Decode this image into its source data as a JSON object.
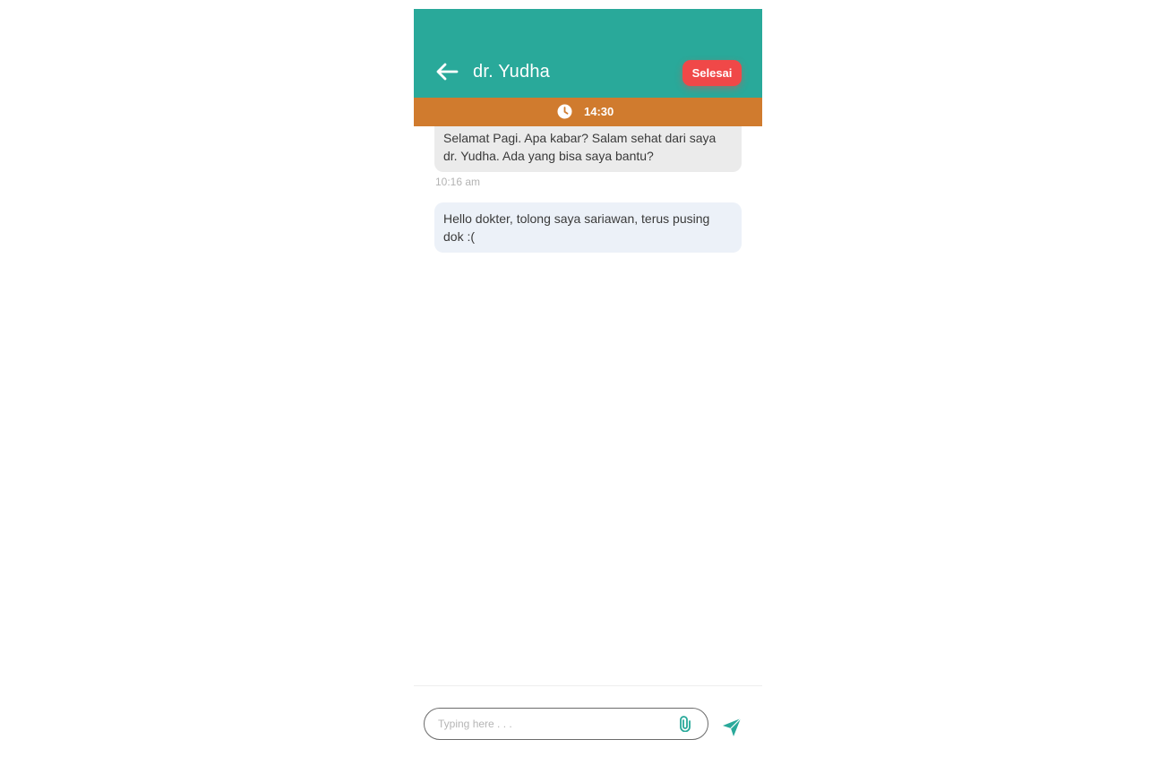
{
  "header": {
    "title": "dr. Yudha",
    "end_button": "Selesai",
    "back_icon": "arrow-left-icon",
    "color": "#29a99a"
  },
  "timer": {
    "value": "14:30",
    "icon": "clock-icon",
    "color": "#d07b2e"
  },
  "messages": [
    {
      "sender": "doctor",
      "text": "Selamat Pagi. Apa kabar? Salam sehat dari saya dr. Yudha. Ada yang bisa saya bantu?",
      "time": "10:16 am"
    },
    {
      "sender": "user",
      "text": "Hello dokter, tolong saya sariawan, terus pusing dok :("
    }
  ],
  "composer": {
    "placeholder": "Typing here . . .",
    "attach_icon": "paperclip-icon",
    "send_icon": "send-icon"
  },
  "colors": {
    "end_button": "#f04848",
    "accent": "#29a99a"
  }
}
